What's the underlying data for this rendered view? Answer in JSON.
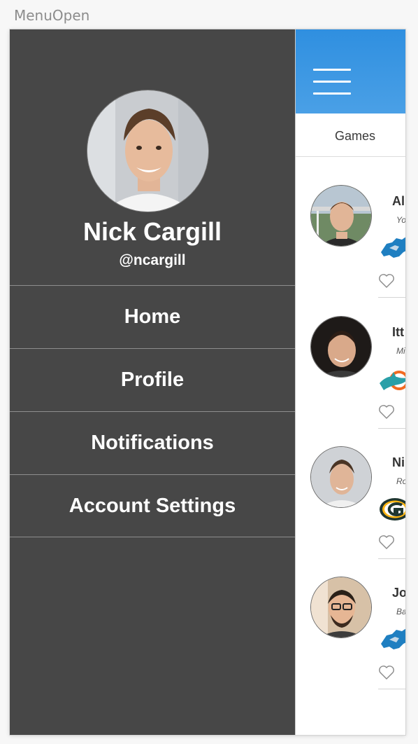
{
  "artboard_label": "MenuOpen",
  "menu": {
    "profile": {
      "name": "Nick Cargill",
      "handle": "@ncargill"
    },
    "items": [
      {
        "label": "Home"
      },
      {
        "label": "Profile"
      },
      {
        "label": "Notifications"
      },
      {
        "label": "Account Settings"
      }
    ]
  },
  "main": {
    "tabs": [
      {
        "label": "Games"
      }
    ],
    "feed": [
      {
        "name": "Al",
        "subtitle": "Yo",
        "team_icon": "lions-logo-icon"
      },
      {
        "name": "Itt",
        "subtitle": "Mi",
        "team_icon": "dolphins-logo-icon"
      },
      {
        "name": "Ni",
        "subtitle": "Ro",
        "team_icon": "packers-logo-icon"
      },
      {
        "name": "Jo",
        "subtitle": "Ba",
        "team_icon": "lions-logo-icon"
      }
    ]
  },
  "colors": {
    "menu_bg": "#474747",
    "topbar_blue": "#3a96e3",
    "divider": "#8e8e8e"
  }
}
